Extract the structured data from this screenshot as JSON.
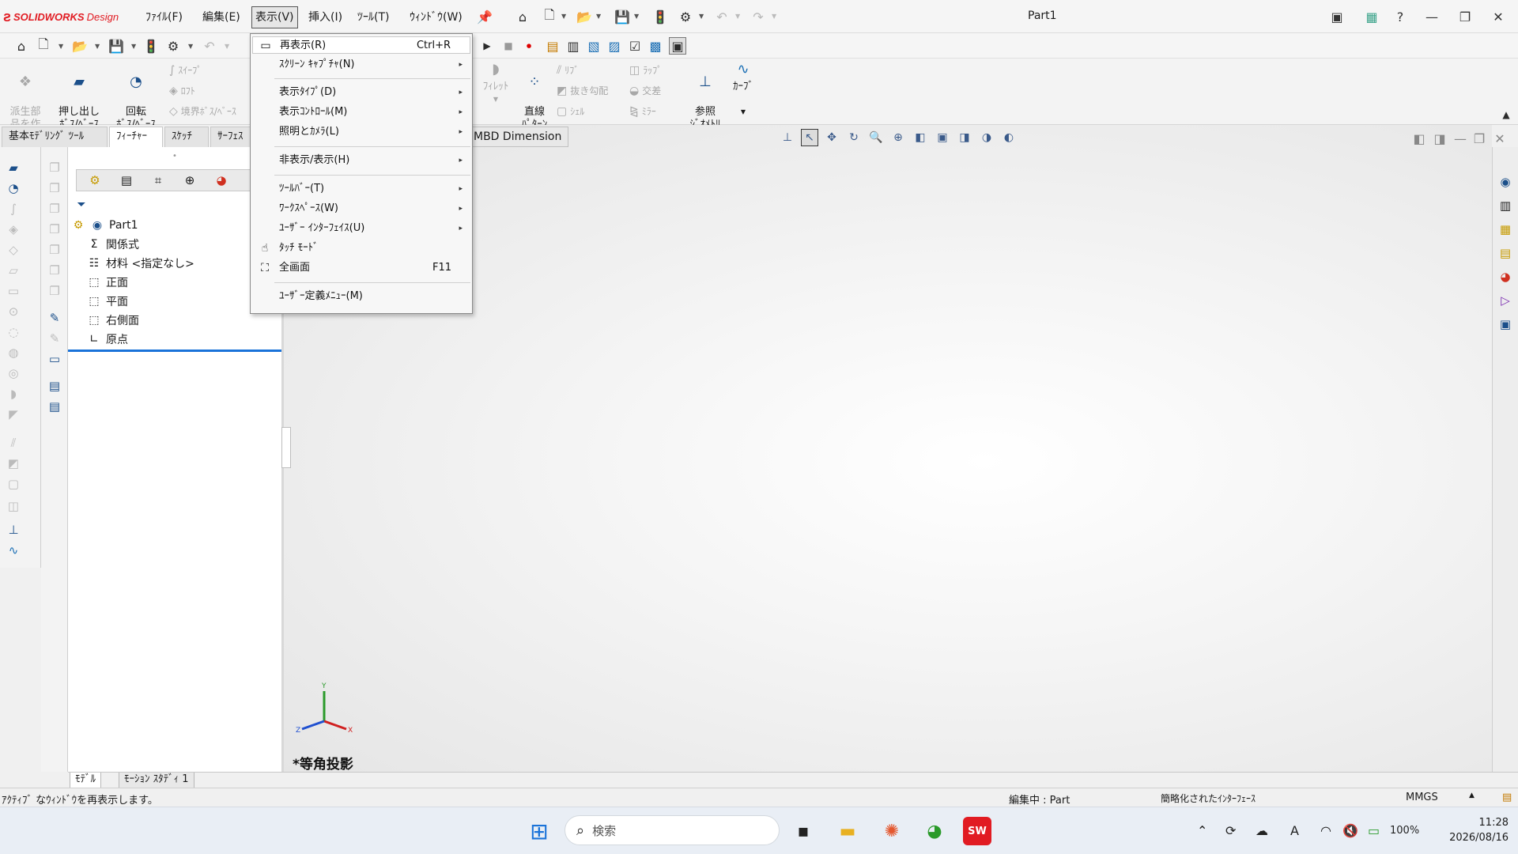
{
  "app": {
    "logo_brand": "SOLIDWORKS",
    "logo_suffix": "Design",
    "document_title": "Part1"
  },
  "menubar": [
    {
      "label": "ﾌｧｲﾙ(F)"
    },
    {
      "label": "編集(E)"
    },
    {
      "label": "表示(V)"
    },
    {
      "label": "挿入(I)"
    },
    {
      "label": "ﾂｰﾙ(T)"
    },
    {
      "label": "ｳｨﾝﾄﾞｳ(W)"
    }
  ],
  "command_manager": {
    "derived_part": "派生部\n品を作\n成",
    "extrude_boss": "押し出し\nﾎﾞｽ/ﾍﾞｰｽ",
    "revolve_boss": "回転\nﾎﾞｽ/ﾍﾞｰｽ",
    "sweep": "ｽｲｰﾌﾟ",
    "loft": "ﾛﾌﾄ",
    "boundary_boss": "境界ﾎﾞｽ/ﾍﾞｰｽ",
    "fillet": "ﾌｨﾚｯﾄ",
    "linear_pattern": "直線\nﾊﾟﾀｰﾝ",
    "rib": "ﾘﾌﾞ",
    "draft": "抜き勾配",
    "shell": "ｼｪﾙ",
    "wrap": "ﾗｯﾌﾟ",
    "intersect": "交差",
    "mirror": "ﾐﾗｰ",
    "ref_geometry": "参照\nｼﾞｵﾒﾄﾘ",
    "curves": "ｶｰﾌﾞ"
  },
  "tabs": [
    {
      "label": "基本ﾓﾃﾞﾘﾝｸﾞ ﾂｰﾙ"
    },
    {
      "label": "ﾌｨｰﾁｬｰ"
    },
    {
      "label": "ｽｹｯﾁ"
    },
    {
      "label": "ｻｰﾌｪｽ"
    }
  ],
  "mbd_tab": "MBD Dimension",
  "feature_tree": {
    "root": "Part1",
    "items": [
      {
        "label": "関係式",
        "icon": "equations-icon"
      },
      {
        "label": "材料 <指定なし>",
        "icon": "material-icon"
      },
      {
        "label": "正面",
        "icon": "plane-icon"
      },
      {
        "label": "平面",
        "icon": "plane-icon"
      },
      {
        "label": "右側面",
        "icon": "plane-icon"
      },
      {
        "label": "原点",
        "icon": "origin-icon"
      }
    ]
  },
  "dropdown": {
    "items": [
      {
        "label": "再表示(R)",
        "shortcut": "Ctrl+R",
        "icon": "redraw-icon",
        "highlighted": true
      },
      {
        "label": "ｽｸﾘｰﾝ ｷｬﾌﾟﾁｬ(N)",
        "submenu": true
      },
      {
        "label": "表示ﾀｲﾌﾟ(D)",
        "submenu": true
      },
      {
        "label": "表示ｺﾝﾄﾛｰﾙ(M)",
        "submenu": true
      },
      {
        "label": "照明とｶﾒﾗ(L)",
        "submenu": true
      },
      {
        "label": "非表示/表示(H)",
        "submenu": true
      },
      {
        "label": "ﾂｰﾙﾊﾞｰ(T)",
        "submenu": true
      },
      {
        "label": "ﾜｰｸｽﾍﾟｰｽ(W)",
        "submenu": true
      },
      {
        "label": "ﾕｰｻﾞｰ ｲﾝﾀｰﾌｪｲｽ(U)",
        "submenu": true
      },
      {
        "label": "ﾀｯﾁ ﾓｰﾄﾞ",
        "icon": "touch-icon"
      },
      {
        "label": "全画面",
        "shortcut": "F11",
        "icon": "fullscreen-icon"
      },
      {
        "label": "ﾕｰｻﾞｰ定義ﾒﾆｭｰ(M)"
      }
    ]
  },
  "graphics": {
    "view_label": "*等角投影",
    "triad": {
      "x": "X",
      "y": "Y",
      "z": "Z"
    }
  },
  "bottom_tabs": [
    {
      "label": "ﾓﾃﾞﾙ"
    },
    {
      "label": "ﾓｰｼｮﾝ ｽﾀﾃﾞｨ 1"
    }
  ],
  "statusbar": {
    "message": "ｱｸﾃｨﾌﾞ なｳｨﾝﾄﾞｳを再表示します。",
    "editing": "編集中 :  Part",
    "interface": "簡略化されたｲﾝﾀｰﾌｪｰｽ",
    "units": "MMGS"
  },
  "taskbar": {
    "search_placeholder": "検索",
    "battery": "100%",
    "time": "11:28",
    "date": "2026/08/16"
  },
  "colors": {
    "brand_red": "#e11b22",
    "accent_blue": "#1a73d9"
  }
}
